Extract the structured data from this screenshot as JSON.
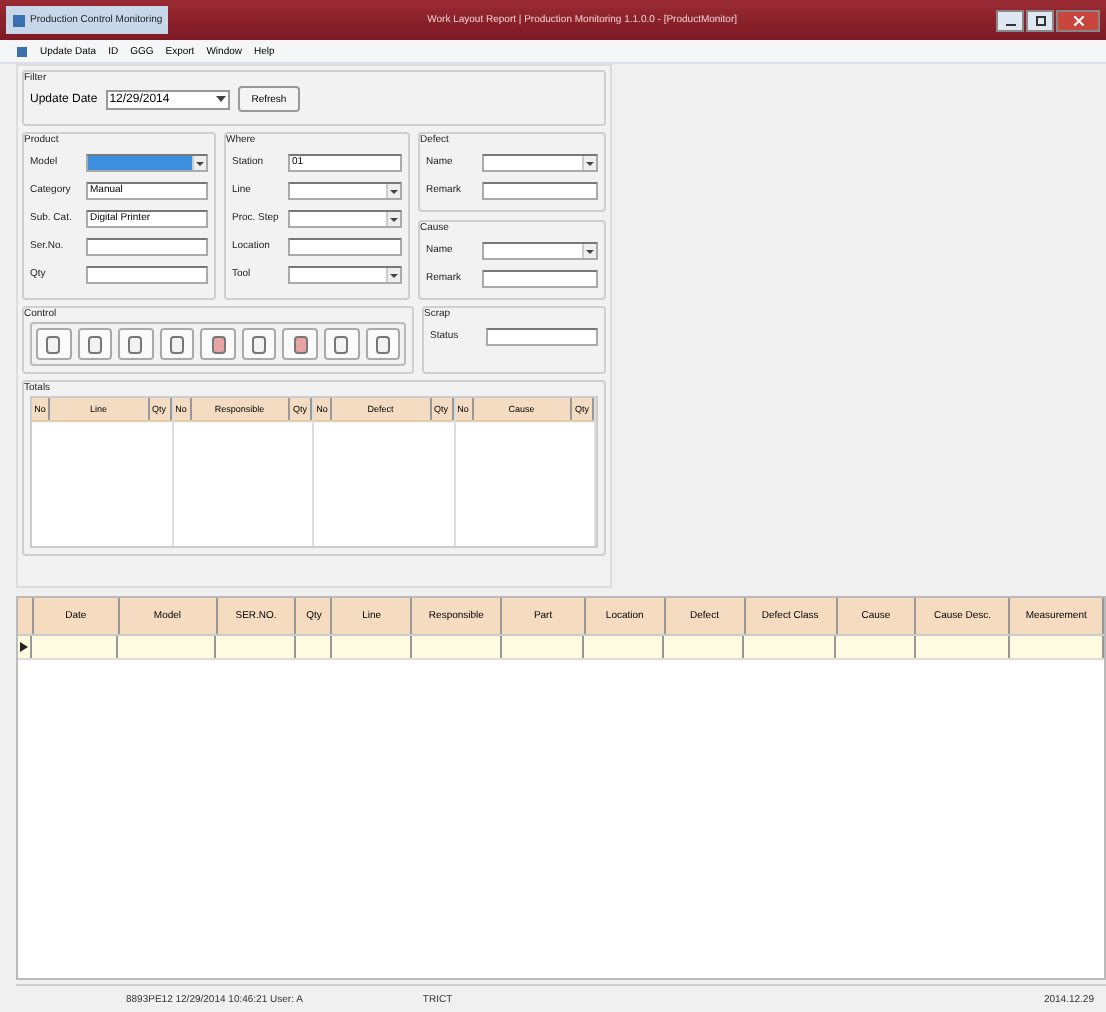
{
  "window": {
    "app_title": "Production Control Monitoring",
    "title": "Work Layout Report | Production Monitoring 1.1.0.0 - [ProductMonitor]"
  },
  "menu": [
    "Update Data",
    "ID",
    "GGG",
    "Export",
    "Window",
    "Help"
  ],
  "filter": {
    "title": "Filter",
    "date_label": "Update Date",
    "date_value": "12/29/2014",
    "refresh": "Refresh"
  },
  "groups": [
    {
      "title": "Product",
      "fields": [
        {
          "label": "Model",
          "kind": "combo",
          "highlighted": true
        },
        {
          "label": "Category",
          "kind": "text",
          "value": "Manual",
          "highlighted": false
        },
        {
          "label": "Sub. Cat.",
          "kind": "text",
          "value": "Digital Printer",
          "highlighted": false
        },
        {
          "label": "Ser.No.",
          "kind": "text",
          "highlighted": false
        },
        {
          "label": "Qty",
          "kind": "text",
          "highlighted": false
        }
      ]
    },
    {
      "title": "Where",
      "fields": [
        {
          "label": "Station",
          "kind": "text",
          "value": "01",
          "highlighted": false
        },
        {
          "label": "Line",
          "kind": "combo",
          "highlighted": false
        },
        {
          "label": "Proc. Step",
          "kind": "combo",
          "highlighted": false
        },
        {
          "label": "Location",
          "kind": "text",
          "highlighted": false
        },
        {
          "label": "Tool",
          "kind": "combo",
          "highlighted": false
        }
      ]
    },
    {
      "title": "Defect",
      "fields": [
        {
          "label": "Name",
          "kind": "combo",
          "highlighted": false
        },
        {
          "label": "Remark",
          "kind": "text",
          "highlighted": false
        }
      ]
    },
    {
      "title": "Cause",
      "fields": [
        {
          "label": "Name",
          "kind": "combo",
          "highlighted": false
        },
        {
          "label": "Remark",
          "kind": "text",
          "highlighted": false
        }
      ]
    }
  ],
  "control": {
    "title": "Control",
    "buttons": [
      {
        "color": "#f2f2f2"
      },
      {
        "color": "#f2f2f2"
      },
      {
        "color": "#f2f2f2"
      },
      {
        "color": "#f2f2f2"
      },
      {
        "color": "#e9a3a3"
      },
      {
        "color": "#f2f2f2"
      },
      {
        "color": "#e9a3a3"
      },
      {
        "color": "#f2f2f2"
      },
      {
        "color": "#f2f2f2"
      }
    ]
  },
  "scrap": {
    "title": "Scrap",
    "fields": [
      {
        "label": "Status",
        "kind": "text",
        "highlighted": false
      }
    ]
  },
  "totals": {
    "title": "Totals",
    "tables": [
      [
        "No",
        "Line",
        "Qty"
      ],
      [
        "No",
        "Responsible",
        "Qty"
      ],
      [
        "No",
        "Defect",
        "Qty"
      ],
      [
        "No",
        "Cause",
        "Qty"
      ]
    ]
  },
  "grid": {
    "columns": [
      "Date",
      "Model",
      "SER.NO.",
      "Qty",
      "Line",
      "Responsible",
      "Part",
      "Location",
      "Defect",
      "Defect Class",
      "Cause",
      "Cause Desc.",
      "Measurement"
    ]
  },
  "status_bar": [
    "8893PE12 12/29/2014 10:46:21 User: A",
    "TRICT",
    "2014.12.29"
  ]
}
